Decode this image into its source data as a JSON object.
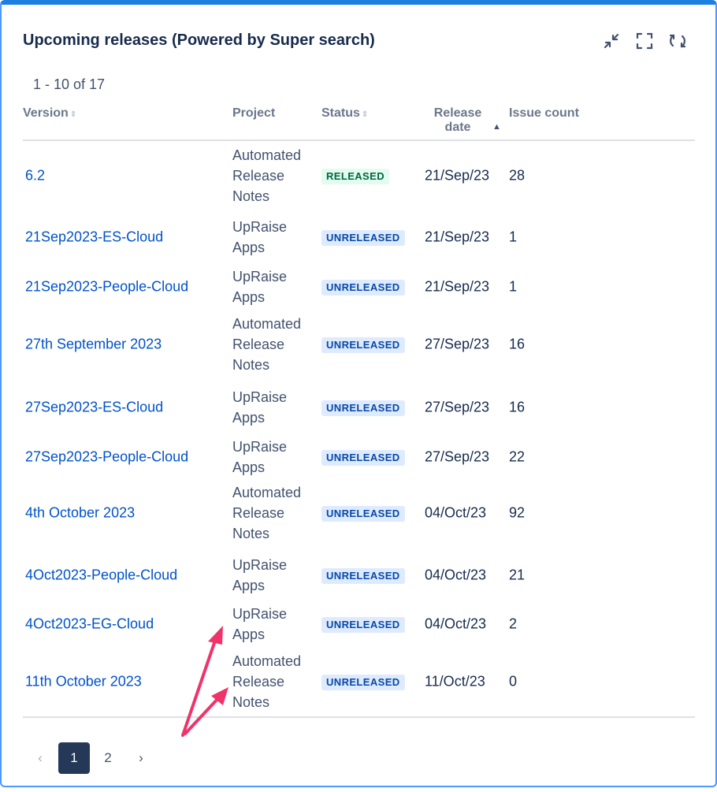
{
  "panel": {
    "title": "Upcoming releases (Powered by Super search)",
    "tools": [
      "minimize-icon",
      "fullscreen-icon",
      "refresh-icon"
    ]
  },
  "pagination_summary": "1 - 10 of 17",
  "columns": {
    "version": "Version",
    "project": "Project",
    "status": "Status",
    "release_date": "Release date",
    "issue_count": "Issue count"
  },
  "rows": [
    {
      "version": "6.2",
      "project": "Automated Release Notes",
      "status": "RELEASED",
      "date": "21/Sep/23",
      "issues": "28"
    },
    {
      "version": "21Sep2023-ES-Cloud",
      "project": "UpRaise Apps",
      "status": "UNRELEASED",
      "date": "21/Sep/23",
      "issues": "1"
    },
    {
      "version": "21Sep2023-People-Cloud",
      "project": "UpRaise Apps",
      "status": "UNRELEASED",
      "date": "21/Sep/23",
      "issues": "1"
    },
    {
      "version": "27th September 2023",
      "project": "Automated Release Notes",
      "status": "UNRELEASED",
      "date": "27/Sep/23",
      "issues": "16"
    },
    {
      "version": "27Sep2023-ES-Cloud",
      "project": "UpRaise Apps",
      "status": "UNRELEASED",
      "date": "27/Sep/23",
      "issues": "16"
    },
    {
      "version": "27Sep2023-People-Cloud",
      "project": "UpRaise Apps",
      "status": "UNRELEASED",
      "date": "27/Sep/23",
      "issues": "22"
    },
    {
      "version": "4th October 2023",
      "project": "Automated Release Notes",
      "status": "UNRELEASED",
      "date": "04/Oct/23",
      "issues": "92"
    },
    {
      "version": "4Oct2023-People-Cloud",
      "project": "UpRaise Apps",
      "status": "UNRELEASED",
      "date": "04/Oct/23",
      "issues": "21"
    },
    {
      "version": "4Oct2023-EG-Cloud",
      "project": "UpRaise Apps",
      "status": "UNRELEASED",
      "date": "04/Oct/23",
      "issues": "2"
    },
    {
      "version": "11th October 2023",
      "project": "Automated Release Notes",
      "status": "UNRELEASED",
      "date": "11/Oct/23",
      "issues": "0"
    }
  ],
  "pager": {
    "prev": "‹",
    "pages": [
      "1",
      "2"
    ],
    "current": "1",
    "next": "›"
  },
  "colors": {
    "link": "#0052cc",
    "accent_border": "#1f7fe0",
    "released_bg": "#e3fcef",
    "unreleased_bg": "#deebff",
    "annotation_arrow": "#f0336b"
  }
}
